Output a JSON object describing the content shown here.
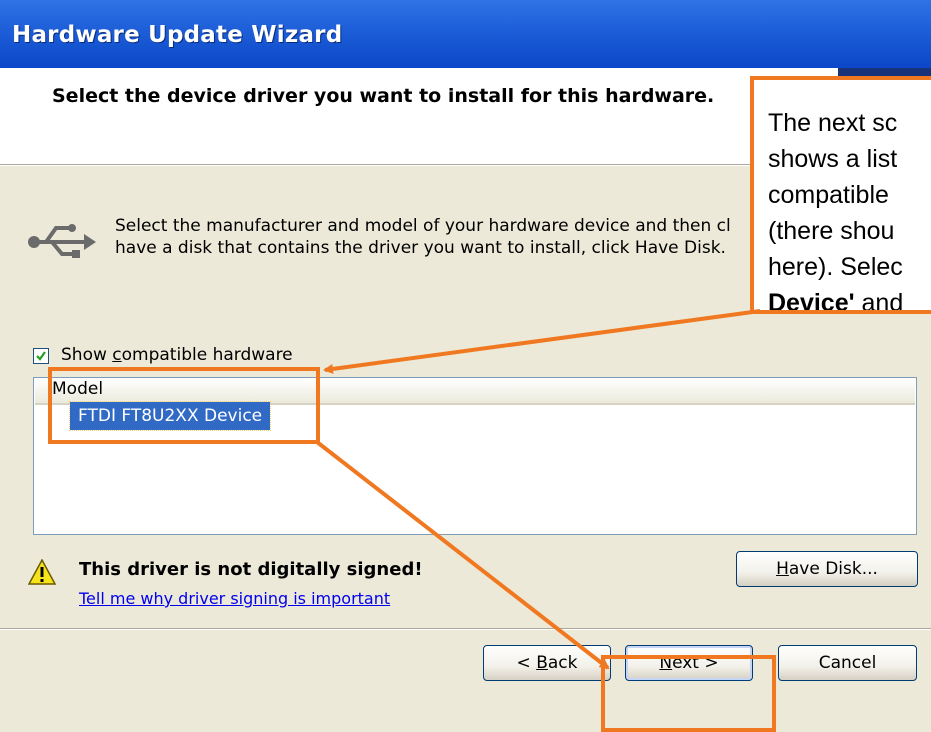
{
  "window": {
    "title": "Hardware Update Wizard"
  },
  "header": {
    "heading": "Select the device driver you want to install for this hardware."
  },
  "description": {
    "line1": "Select the manufacturer and model of your hardware device and then cl",
    "line2": "have a disk that contains the driver you want to install, click Have Disk."
  },
  "compatible_checkbox": {
    "label_before": "Show ",
    "label_accel": "c",
    "label_after": "ompatible hardware",
    "checked": true
  },
  "model_list": {
    "header": "Model",
    "items": [
      "FTDI FT8U2XX Device"
    ],
    "selected_index": 0
  },
  "warning": {
    "text": "This driver is not digitally signed!",
    "link": "Tell me why driver signing is important"
  },
  "buttons": {
    "have_disk": {
      "accel": "H",
      "rest": "ave Disk..."
    },
    "back": {
      "prefix": "< ",
      "accel": "B",
      "rest": "ack"
    },
    "next": {
      "accel": "N",
      "rest": "ext >"
    },
    "cancel": "Cancel"
  },
  "callout": {
    "lines": [
      "The next sc",
      "shows a list",
      "compatible",
      "(there shou",
      "here). Selec"
    ],
    "bold_part": "Device'",
    "tail": " and"
  },
  "colors": {
    "titlebar": "#0b47c8",
    "annotation": "#f07820",
    "selection": "#316ac5",
    "link": "#0000ee"
  }
}
